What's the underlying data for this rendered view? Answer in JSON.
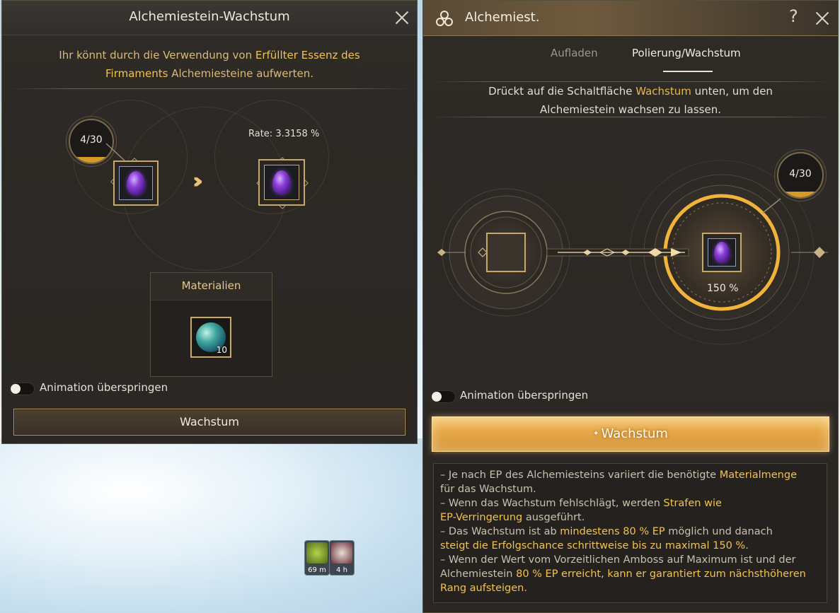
{
  "left_panel": {
    "title": "Alchemiestein-Wachstum",
    "info": {
      "part1": "Ihr könnt durch die Verwendung von ",
      "highlight1": "Erfüllter Essenz des",
      "highlight2": "Firmaments",
      "part2": " Alchemiesteine aufwerten."
    },
    "level": "4/30",
    "rate": "Rate: 3.3158 %",
    "materials_header": "Materialien",
    "material_count": "10",
    "skip_animation": "Animation überspringen",
    "button": "Wachstum"
  },
  "mini_icons": [
    {
      "label": "69 m",
      "icon": "pickaxe-icon"
    },
    {
      "label": "4 h",
      "icon": "pouch-icon"
    }
  ],
  "right_panel": {
    "title": "Alchemiest.",
    "help": "?",
    "tabs": [
      {
        "label": "Aufladen",
        "active": false
      },
      {
        "label": "Polierung/Wachstum",
        "active": true
      }
    ],
    "info": {
      "part1": "Drückt auf die Schaltfläche ",
      "highlight": "Wachstum",
      "part2": " unten, um den",
      "line2": "Alchemiestein wachsen zu lassen."
    },
    "level": "4/30",
    "percent": "150 %",
    "skip_animation": "Animation überspringen",
    "button": "Wachstum",
    "notes": {
      "n1a": "– Je nach EP des Alchemiesteins variiert die benötigte ",
      "n1h": "Materialmenge",
      "n1b": "für das Wachstum.",
      "n2a": "– Wenn das Wachstum fehlschlägt, werden ",
      "n2h": "Strafen wie",
      "n2h2": "EP-Verringerung",
      "n2b": " ausgeführt.",
      "n3a": "– Das Wachstum ist ab ",
      "n3h": "mindestens 80 % EP",
      "n3b": " möglich und danach",
      "n3h2": "steigt die Erfolgschance schrittweise bis zu maximal 150 %",
      "n3c": ".",
      "n4a": "– Wenn der Wert vom Vorzeitlichen Amboss auf Maximum ist und der",
      "n4b": "Alchemiestein ",
      "n4h": "80 % EP erreicht, kann er garantiert zum nächsthöheren",
      "n4h2": "Rang aufsteigen",
      "n4c": "."
    }
  },
  "colors": {
    "highlight": "#f2c34e",
    "panel_bg": "#2e2a26",
    "button_gold": "#e7a94a"
  }
}
